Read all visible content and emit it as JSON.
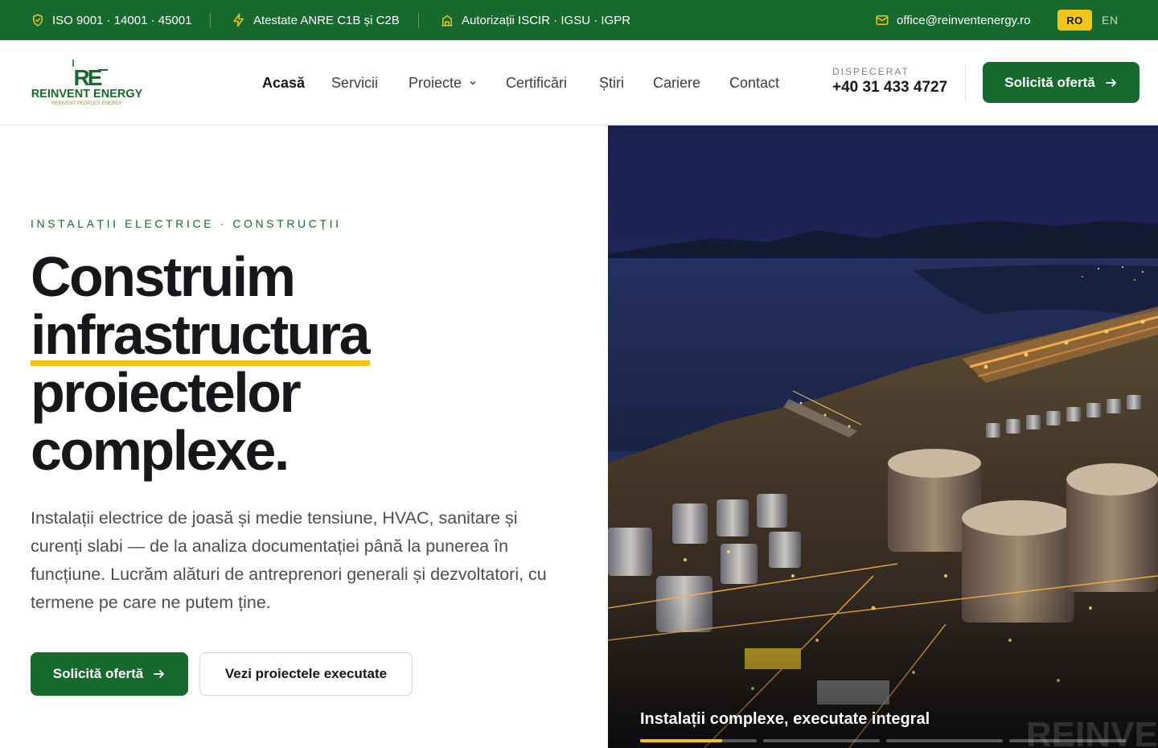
{
  "topbar": {
    "iso": "ISO 9001 · 14001 · 45001",
    "anre": "Atestate ANRE C1B și C2B",
    "iscir": "Autorizații ISCIR · IGSU · IGPR",
    "email": "office@reinventenergy.ro",
    "lang_active": "RO",
    "lang_other": "EN",
    "icons": [
      "shield-check-icon",
      "lightning-icon",
      "building-icon",
      "mail-icon"
    ]
  },
  "header": {
    "logo_mark": "RE",
    "logo_name": "REINVENT ENERGY",
    "logo_tagline": "REINVENT PEOPLE'S ENERGY",
    "nav": [
      "Acasă",
      "Servicii",
      "Proiecte",
      "Certificări",
      "Știri",
      "Cariere",
      "Contact"
    ],
    "nav_active": "Acasă",
    "dispatch_label": "DISPECERAT",
    "dispatch_phone": "+40 31 433 4727",
    "cta": "Solicită ofertă"
  },
  "hero": {
    "eyebrow": "INSTALAȚII ELECTRICE · CONSTRUCȚII",
    "title_line1": "Construim",
    "title_line2": "infrastructura",
    "title_line3": "proiectelor",
    "title_line4": "complexe.",
    "lead": "Instalații electrice de joasă și medie tensiune, HVAC, sanitare și curenți slabi — de la analiza documentației până la punerea în funcțiune. Lucrăm alături de antreprenori generali și dezvoltatori, cu termene pe care ne putem ține.",
    "cta_primary": "Solicită ofertă",
    "cta_secondary": "Vezi proiectele executate",
    "slide_caption": "Instalații complexe, executate integral",
    "slide_watermark": "REINVEN",
    "slides_total": 4,
    "slide_active": 1,
    "slide_active_progress": 0.7
  },
  "colors": {
    "brand_green": "#17692e",
    "accent_yellow": "#f0c419",
    "text_dark": "#15171a"
  }
}
